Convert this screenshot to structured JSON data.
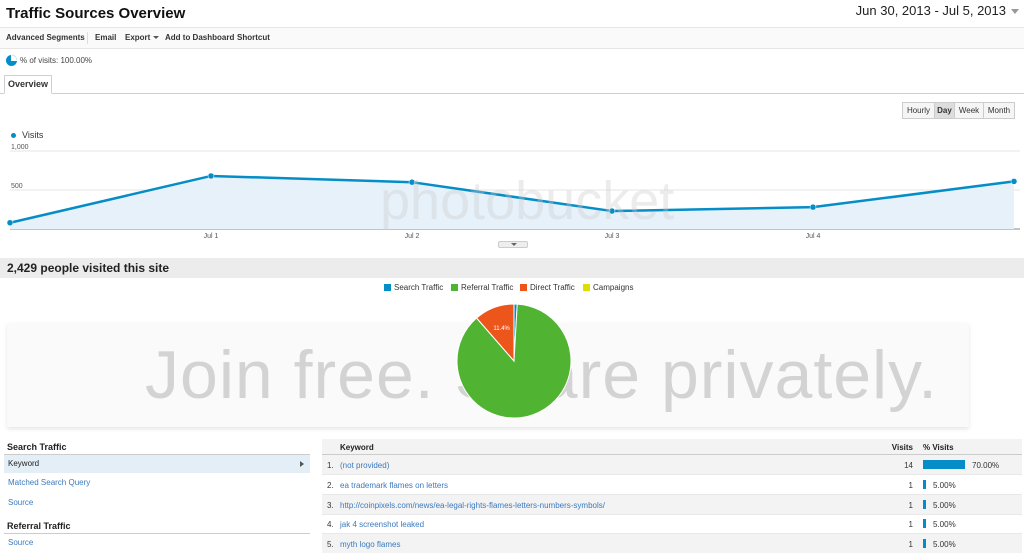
{
  "header": {
    "title": "Traffic Sources Overview",
    "date_range": "Jun 30, 2013 - Jul 5, 2013"
  },
  "toolbar": {
    "advanced_segments": "Advanced Segments",
    "email": "Email",
    "export": "Export",
    "add_to_dashboard": "Add to Dashboard",
    "shortcut": "Shortcut"
  },
  "segment": {
    "label": "% of visits: 100.00%"
  },
  "tabs": [
    {
      "label": "Overview"
    }
  ],
  "granularity": [
    "Hourly",
    "Day",
    "Week",
    "Month"
  ],
  "granularity_active": "Day",
  "chart_data": [
    {
      "type": "area",
      "series": [
        {
          "name": "Visits",
          "values": [
            80,
            680,
            600,
            230,
            280,
            610
          ]
        }
      ],
      "categories": [
        "Jun 30",
        "Jul 1",
        "Jul 2",
        "Jul 3",
        "Jul 4",
        "Jul 5"
      ],
      "y_tick_labels": [
        "1,000",
        "500"
      ],
      "x_tick_labels": [
        "Jul 1",
        "Jul 2",
        "Jul 3",
        "Jul 4"
      ],
      "ylim": [
        0,
        1000
      ],
      "color": "#058dc7"
    },
    {
      "type": "pie",
      "categories": [
        "Search Traffic",
        "Referral Traffic",
        "Direct Traffic",
        "Campaigns"
      ],
      "values": [
        87.7,
        0.9,
        11.4,
        0
      ],
      "slice_labels": [
        "87.7%",
        "",
        "11.4%",
        ""
      ],
      "colors": [
        "#50b432",
        "#058dc7",
        "#ed561b",
        "#dddf00"
      ]
    }
  ],
  "summary": {
    "text": "2,429 people visited this site"
  },
  "pie_legend": [
    {
      "label": "Search Traffic",
      "color": "#058dc7"
    },
    {
      "label": "Referral Traffic",
      "color": "#50b432"
    },
    {
      "label": "Direct Traffic",
      "color": "#ed561b"
    },
    {
      "label": "Campaigns",
      "color": "#dddf00"
    }
  ],
  "watermark": {
    "text": "Join free. Share privately.",
    "brand": "photobucket"
  },
  "left_panel": {
    "search_header": "Search Traffic",
    "search_items": [
      "Keyword",
      "Matched Search Query",
      "Source"
    ],
    "referral_header": "Referral Traffic",
    "referral_items": [
      "Source"
    ]
  },
  "keyword_table": {
    "col_keyword": "Keyword",
    "col_visits": "Visits",
    "col_pct": "% Visits",
    "rows": [
      {
        "idx": "1.",
        "keyword": "(not provided)",
        "visits": "14",
        "pct": "70.00%",
        "share": 0.7
      },
      {
        "idx": "2.",
        "keyword": "ea trademark flames on letters",
        "visits": "1",
        "pct": "5.00%",
        "share": 0.05
      },
      {
        "idx": "3.",
        "keyword": "http://coinpixels.com/news/ea-legal-rights-flames-letters-numbers-symbols/",
        "visits": "1",
        "pct": "5.00%",
        "share": 0.05
      },
      {
        "idx": "4.",
        "keyword": "jak 4 screenshot leaked",
        "visits": "1",
        "pct": "5.00%",
        "share": 0.05
      },
      {
        "idx": "5.",
        "keyword": "myth logo flames",
        "visits": "1",
        "pct": "5.00%",
        "share": 0.05
      }
    ]
  }
}
